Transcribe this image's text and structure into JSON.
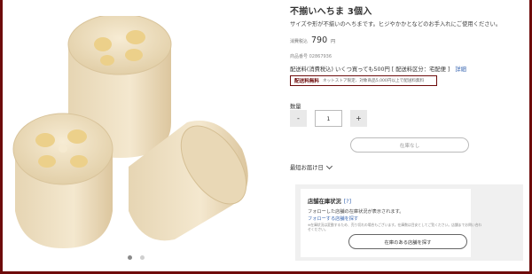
{
  "product": {
    "title": "不揃いへちま 3個入",
    "description": "サイズや形が不揃いのへちまです。ヒジやかかとなどのお手入れにご使用ください。",
    "price_label": "消費税込",
    "price": "790",
    "price_unit": "円",
    "code": "商品番号 02867936",
    "shipping": "配送料(消費税込) いくつ買っても500円 [ 配送料区分：宅配便 ]",
    "shipping_link": "詳細",
    "free_tag": "配送料無料",
    "free_note": "ネットストア限定、対象商品5,000円以上で配送料無料"
  },
  "quantity": {
    "label": "数量",
    "minus": "-",
    "plus": "+",
    "value": "1"
  },
  "stock_button": "在庫なし",
  "delivery_label": "最短お届け日",
  "store_stock": {
    "heading": "店舗在庫状況",
    "help": "[?]",
    "note": "フォローした店舗の在庫状況が表示されます。",
    "follow_link": "フォローする店舗を探す",
    "small_text": "※在庫状況は変動するため、売り切れの場合もございます。在庫数は目安としてご覧ください。店舗までお問い合わせください。",
    "find_button": "在庫のある店舗を探す"
  },
  "gallery": {
    "dots": 2,
    "active_dot": 1
  },
  "colors": {
    "frame": "#6e0b0b",
    "link": "#3a67b1",
    "loofah": "#eedfc2"
  }
}
